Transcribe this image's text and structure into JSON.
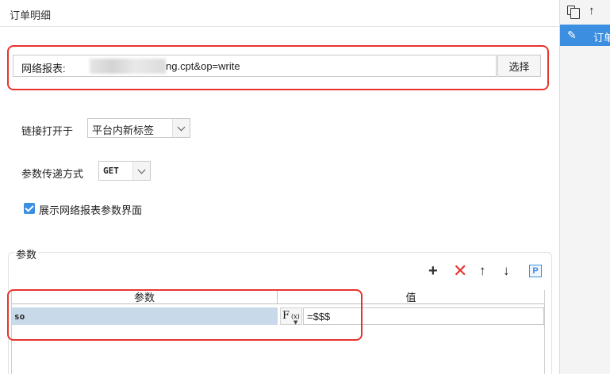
{
  "header": {
    "title": "订单明细"
  },
  "right_panel": {
    "toolbar": {
      "copy_icon": "copy-icon",
      "up_icon": "arrow-up-icon"
    },
    "item": {
      "icon": "pencil-icon",
      "label": "订单"
    }
  },
  "url": {
    "label": "网络报表:",
    "value": "ng.cpt&op=write",
    "select_label": "选择"
  },
  "open_link": {
    "label": "链接打开于",
    "value": "平台内新标签"
  },
  "param_pass": {
    "label": "参数传递方式",
    "value": "GET"
  },
  "show_params": {
    "label": "展示网络报表参数界面",
    "checked": true
  },
  "params": {
    "title": "参数",
    "toolbar": {
      "add": "+",
      "delete": "✕",
      "up": "🡑",
      "down": "🡓",
      "p": "P"
    },
    "columns": [
      "参数",
      "值"
    ],
    "rows": [
      {
        "name": "so",
        "value": "=$$$"
      }
    ],
    "fx_label": "F",
    "fx_sub": "(x)"
  },
  "colors": {
    "accent": "#3c8fe0",
    "highlight_red": "#e8332d",
    "selected_row": "#c8d9ea"
  }
}
